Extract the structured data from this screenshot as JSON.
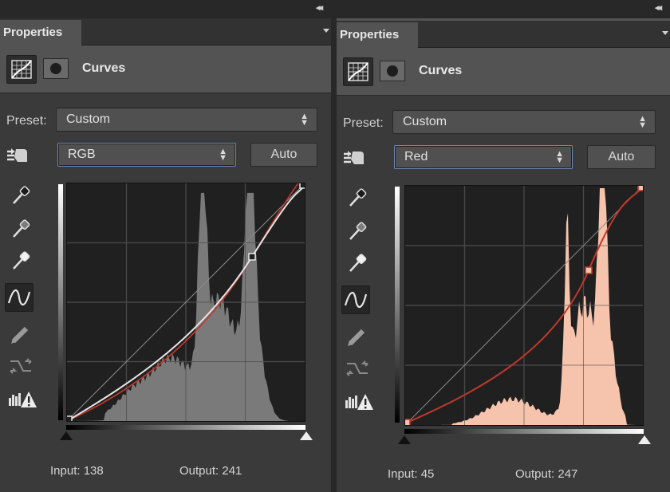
{
  "panels": [
    {
      "tab": "Properties",
      "collapse_glyph": "◂◂",
      "adjustment_title": "Curves",
      "preset": {
        "label": "Preset:",
        "value": "Custom"
      },
      "channel": "RGB",
      "auto_label": "Auto",
      "readout": {
        "input_label": "Input:",
        "input_value": "138",
        "output_label": "Output:",
        "output_value": "241"
      },
      "channel_color": "#c2c2c2",
      "histogram_color": "#7a7a7a"
    },
    {
      "tab": "Properties",
      "collapse_glyph": "◂◂",
      "adjustment_title": "Curves",
      "preset": {
        "label": "Preset:",
        "value": "Custom"
      },
      "channel": "Red",
      "auto_label": "Auto",
      "readout": {
        "input_label": "Input:",
        "input_value": "45",
        "output_label": "Output:",
        "output_value": "247"
      },
      "channel_color": "#c0392b",
      "histogram_color": "#f6c3ad"
    }
  ],
  "tools": [
    "target-adjust-icon",
    "black-eyedropper-icon",
    "gray-eyedropper-icon",
    "white-eyedropper-icon",
    "curve-point-icon",
    "pencil-icon",
    "smooth-icon",
    "clipping-warning-icon"
  ]
}
